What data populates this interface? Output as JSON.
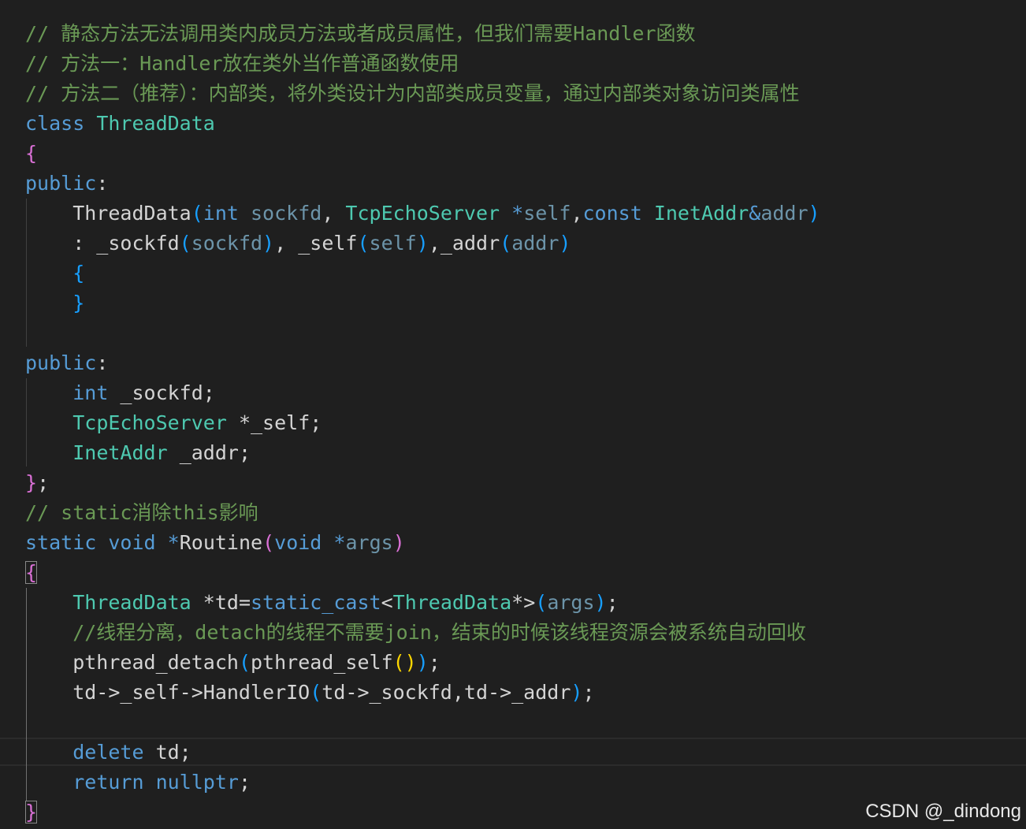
{
  "colors": {
    "background": "#1f1f1f",
    "comment": "#6a9955",
    "keyword": "#569cd6",
    "type": "#4ec9b0",
    "text": "#d4d4d4",
    "bracket_level_1": "#da70d6",
    "bracket_level_2": "#179fff",
    "bracket_level_3": "#ffd700"
  },
  "code_lines": [
    [
      {
        "t": "// 静态方法无法调用类内成员方法或者成员属性，但我们需要Handler函数",
        "k": "comment"
      }
    ],
    [
      {
        "t": "// 方法一：Handler放在类外当作普通函数使用",
        "k": "comment"
      }
    ],
    [
      {
        "t": "// 方法二（推荐）：内部类，将外类设计为内部类成员变量，通过内部类对象访问类属性",
        "k": "comment"
      }
    ],
    [
      {
        "t": "class",
        "k": "keyword"
      },
      {
        "t": " ",
        "k": "ident"
      },
      {
        "t": "ThreadData",
        "k": "type"
      }
    ],
    [
      {
        "t": "{",
        "k": "br1"
      }
    ],
    [
      {
        "t": "public",
        "k": "keyword"
      },
      {
        "t": ":",
        "k": "punct"
      }
    ],
    [
      {
        "t": "    ThreadData",
        "k": "ident"
      },
      {
        "t": "(",
        "k": "br2"
      },
      {
        "t": "int",
        "k": "keyword"
      },
      {
        "t": " ",
        "k": "ident"
      },
      {
        "t": "sockfd",
        "k": "param"
      },
      {
        "t": ", ",
        "k": "punct"
      },
      {
        "t": "TcpEchoServer",
        "k": "type"
      },
      {
        "t": " ",
        "k": "ident"
      },
      {
        "t": "*",
        "k": "keyword"
      },
      {
        "t": "self",
        "k": "param"
      },
      {
        "t": ",",
        "k": "punct"
      },
      {
        "t": "const",
        "k": "keyword"
      },
      {
        "t": " ",
        "k": "ident"
      },
      {
        "t": "InetAddr",
        "k": "type"
      },
      {
        "t": "&",
        "k": "keyword"
      },
      {
        "t": "addr",
        "k": "param"
      },
      {
        "t": ")",
        "k": "br2"
      }
    ],
    [
      {
        "t": "    : _sockfd",
        "k": "ident"
      },
      {
        "t": "(",
        "k": "br2"
      },
      {
        "t": "sockfd",
        "k": "param"
      },
      {
        "t": ")",
        "k": "br2"
      },
      {
        "t": ", _self",
        "k": "ident"
      },
      {
        "t": "(",
        "k": "br2"
      },
      {
        "t": "self",
        "k": "param"
      },
      {
        "t": ")",
        "k": "br2"
      },
      {
        "t": ",_addr",
        "k": "ident"
      },
      {
        "t": "(",
        "k": "br2"
      },
      {
        "t": "addr",
        "k": "param"
      },
      {
        "t": ")",
        "k": "br2"
      }
    ],
    [
      {
        "t": "    ",
        "k": "ident"
      },
      {
        "t": "{",
        "k": "br2"
      }
    ],
    [
      {
        "t": "    ",
        "k": "ident"
      },
      {
        "t": "}",
        "k": "br2"
      }
    ],
    [],
    [
      {
        "t": "public",
        "k": "keyword"
      },
      {
        "t": ":",
        "k": "punct"
      }
    ],
    [
      {
        "t": "    ",
        "k": "ident"
      },
      {
        "t": "int",
        "k": "keyword"
      },
      {
        "t": " _sockfd;",
        "k": "ident"
      }
    ],
    [
      {
        "t": "    ",
        "k": "ident"
      },
      {
        "t": "TcpEchoServer",
        "k": "type"
      },
      {
        "t": " *_self;",
        "k": "ident"
      }
    ],
    [
      {
        "t": "    ",
        "k": "ident"
      },
      {
        "t": "InetAddr",
        "k": "type"
      },
      {
        "t": " _addr;",
        "k": "ident"
      }
    ],
    [
      {
        "t": "}",
        "k": "br1"
      },
      {
        "t": ";",
        "k": "punct"
      }
    ],
    [
      {
        "t": "// static消除this影响",
        "k": "comment"
      }
    ],
    [
      {
        "t": "static",
        "k": "keyword"
      },
      {
        "t": " ",
        "k": "ident"
      },
      {
        "t": "void",
        "k": "keyword"
      },
      {
        "t": " ",
        "k": "ident"
      },
      {
        "t": "*",
        "k": "keyword"
      },
      {
        "t": "Routine",
        "k": "ident"
      },
      {
        "t": "(",
        "k": "br1"
      },
      {
        "t": "void",
        "k": "keyword"
      },
      {
        "t": " ",
        "k": "ident"
      },
      {
        "t": "*",
        "k": "keyword"
      },
      {
        "t": "args",
        "k": "param"
      },
      {
        "t": ")",
        "k": "br1"
      }
    ],
    [
      {
        "t": "{",
        "k": "br1",
        "m": true
      }
    ],
    [
      {
        "t": "    ",
        "k": "ident"
      },
      {
        "t": "ThreadData",
        "k": "type"
      },
      {
        "t": " *td=",
        "k": "ident"
      },
      {
        "t": "static_cast",
        "k": "keyword"
      },
      {
        "t": "<",
        "k": "punct"
      },
      {
        "t": "ThreadData",
        "k": "type"
      },
      {
        "t": "*>",
        "k": "punct"
      },
      {
        "t": "(",
        "k": "br2"
      },
      {
        "t": "args",
        "k": "param"
      },
      {
        "t": ")",
        "k": "br2"
      },
      {
        "t": ";",
        "k": "punct"
      }
    ],
    [
      {
        "t": "    //线程分离，detach的线程不需要join，结束的时候该线程资源会被系统自动回收",
        "k": "comment"
      }
    ],
    [
      {
        "t": "    pthread_detach",
        "k": "ident"
      },
      {
        "t": "(",
        "k": "br2"
      },
      {
        "t": "pthread_self",
        "k": "ident"
      },
      {
        "t": "()",
        "k": "br3"
      },
      {
        "t": ")",
        "k": "br2"
      },
      {
        "t": ";",
        "k": "punct"
      }
    ],
    [
      {
        "t": "    td->_self->HandlerIO",
        "k": "ident"
      },
      {
        "t": "(",
        "k": "br2"
      },
      {
        "t": "td->_sockfd,td->_addr",
        "k": "ident"
      },
      {
        "t": ")",
        "k": "br2"
      },
      {
        "t": ";",
        "k": "punct"
      }
    ],
    [],
    [
      {
        "t": "    ",
        "k": "ident"
      },
      {
        "t": "delete",
        "k": "keyword"
      },
      {
        "t": " td;",
        "k": "ident"
      }
    ],
    [
      {
        "t": "    ",
        "k": "ident"
      },
      {
        "t": "return",
        "k": "keyword"
      },
      {
        "t": " ",
        "k": "ident"
      },
      {
        "t": "nullptr",
        "k": "keyword"
      },
      {
        "t": ";",
        "k": "punct"
      }
    ],
    [
      {
        "t": "}",
        "k": "br1",
        "m": true
      }
    ]
  ],
  "watermark": "CSDN @_dindong"
}
